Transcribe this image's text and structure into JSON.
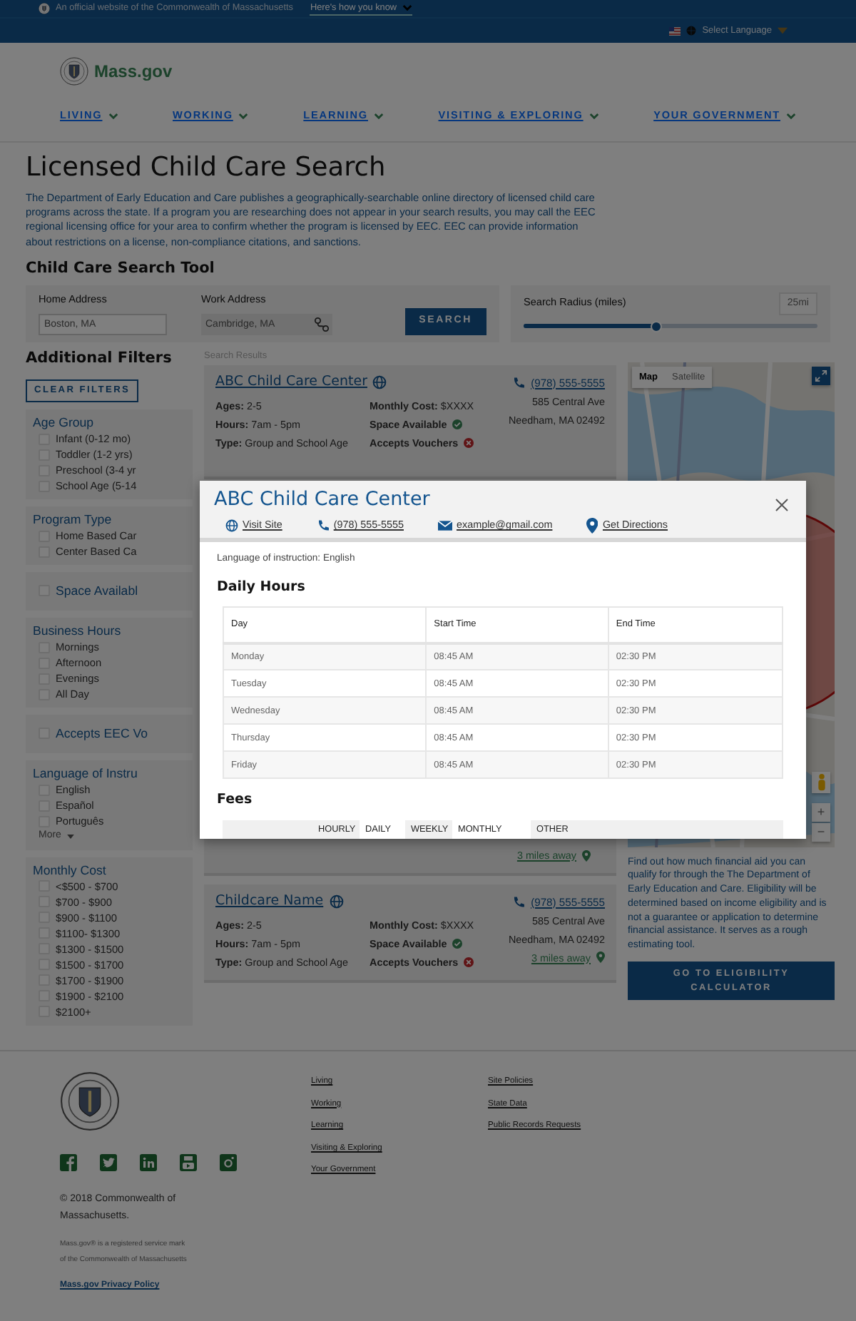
{
  "banner": {
    "text": "An official website of the Commonwealth of Massachusetts",
    "link": "Here's how you know"
  },
  "language_bar": {
    "label": "Select Language"
  },
  "header": {
    "logo": "Mass.gov",
    "nav": [
      "LIVING",
      "WORKING",
      "LEARNING",
      "VISITING & EXPLORING",
      "YOUR GOVERNMENT"
    ]
  },
  "intro": {
    "title": "Licensed Child Care Search",
    "text": "The Department of Early Education and Care publishes a geographically-searchable online directory of licensed child care programs across the state. If a program you are researching does not appear in your search results, you may call the EEC regional licensing office for your area to confirm whether the program is licensed by EEC. EEC can provide information about restrictions on a license, non-compliance citations, and sanctions."
  },
  "search_tool": {
    "title": "Child Care Search Tool",
    "home_address": {
      "label": "Home Address",
      "value": "Boston, MA"
    },
    "work_address": {
      "label": "Work Address",
      "value": "Cambridge, MA"
    },
    "search_button": "SEARCH",
    "radius": {
      "label": "Search Radius (miles)",
      "reading": "25mi",
      "level": 0.45
    }
  },
  "filters": {
    "title": "Additional Filters",
    "clear_button": "CLEAR FILTERS",
    "groups": [
      {
        "kind": "list",
        "title": "Age Group",
        "options": [
          {
            "label": "Infant (0-12 mo)",
            "checked": false
          },
          {
            "label": "Toddler (1-2 yrs)",
            "checked": false
          },
          {
            "label": "Preschool (3-4 yr",
            "checked": false
          },
          {
            "label": "School Age (5-14",
            "checked": false
          }
        ]
      },
      {
        "kind": "list",
        "title": "Program Type",
        "options": [
          {
            "label": "Home Based Car",
            "checked": false
          },
          {
            "label": "Center Based Ca",
            "checked": false
          }
        ]
      },
      {
        "kind": "toggle",
        "title": "Space Availabl",
        "checked": false
      },
      {
        "kind": "list",
        "title": "Business Hours",
        "options": [
          {
            "label": "Mornings",
            "checked": false
          },
          {
            "label": "Afternoon",
            "checked": false
          },
          {
            "label": "Evenings",
            "checked": false
          },
          {
            "label": "All Day",
            "checked": false
          }
        ]
      },
      {
        "kind": "toggle",
        "title": "Accepts EEC Vo",
        "checked": false
      },
      {
        "kind": "list",
        "title": "Language of Instru",
        "options": [
          {
            "label": "English",
            "checked": false
          },
          {
            "label": "Español",
            "checked": false
          },
          {
            "label": "Português",
            "checked": false
          }
        ],
        "more": "More"
      },
      {
        "kind": "list",
        "title": "Monthly Cost",
        "options": [
          {
            "label": "<$500 - $700",
            "checked": false
          },
          {
            "label": "$700 - $900",
            "checked": false
          },
          {
            "label": "$900 - $1100",
            "checked": false
          },
          {
            "label": "$1100- $1300",
            "checked": false
          },
          {
            "label": "$1300 - $1500",
            "checked": false
          },
          {
            "label": "$1500 - $1700",
            "checked": false
          },
          {
            "label": "$1700 - $1900",
            "checked": false
          },
          {
            "label": "$1900 - $2100",
            "checked": false
          },
          {
            "label": "$2100+",
            "checked": false
          }
        ]
      }
    ]
  },
  "results": {
    "label": "Search Results",
    "cards": [
      {
        "kind": "full",
        "name": "ABC Child Care Center",
        "details": [
          "**Ages:** 2-5",
          "**Hours:** 7am - 5pm",
          "**Type:** Group and School Age"
        ],
        "facts": [
          {
            "kind": "text",
            "text": "**Monthly Cost:** $XXXX"
          },
          {
            "kind": "flag",
            "text": "Space Available",
            "positive": true
          },
          {
            "kind": "flag",
            "text": "Accepts Vouchers",
            "positive": false
          }
        ],
        "phone": "(978) 555-5555",
        "address": [
          "585 Central Ave",
          "Needham, MA 02492"
        ]
      },
      {
        "kind": "partial",
        "distance": "3 miles away"
      },
      {
        "kind": "full",
        "name": "Childcare Name",
        "details": [
          "**Ages:** 2-5",
          "**Hours:** 7am - 5pm",
          "**Type:** Group and School Age"
        ],
        "facts": [
          {
            "kind": "text",
            "text": "**Monthly Cost:** $XXXX"
          },
          {
            "kind": "flag",
            "text": "Space Available",
            "positive": true
          },
          {
            "kind": "flag",
            "text": "Accepts Vouchers",
            "positive": false
          }
        ],
        "phone": "(978) 555-5555",
        "address": [
          "585 Central Ave",
          "Needham, MA 02492"
        ],
        "distance": "3 miles away"
      }
    ]
  },
  "map": {
    "tabs": [
      {
        "label": "Map",
        "selected": true
      },
      {
        "label": "Satellite",
        "selected": false
      }
    ],
    "zoom_in": "+",
    "zoom_out": "−"
  },
  "aid": {
    "text": "Find out how much financial aid you can qualify for through the The Department of Early Education and Care. Eligibility will be determined based on income eligibility and is not a guarantee or application to determine financial assistance. It serves as a rough estimating tool.",
    "button": "GO TO ELIGIBILITY CALCULATOR"
  },
  "modal": {
    "title": "ABC Child Care Center",
    "actions": [
      {
        "kind": "web",
        "label": "Visit Site"
      },
      {
        "kind": "phone",
        "label": "(978) 555-5555"
      },
      {
        "kind": "email",
        "label": "example@gmail.com"
      },
      {
        "kind": "directions",
        "label": "Get Directions"
      }
    ],
    "language": "Language of instruction: English",
    "hours_title": "Daily Hours",
    "hours": {
      "columns": [
        "Day",
        "Start Time",
        "End Time"
      ],
      "rows": [
        [
          "Monday",
          "08:45 AM",
          "02:30 PM"
        ],
        [
          "Tuesday",
          "08:45 AM",
          "02:30 PM"
        ],
        [
          "Wednesday",
          "08:45 AM",
          "02:30 PM"
        ],
        [
          "Thursday",
          "08:45 AM",
          "02:30 PM"
        ],
        [
          "Friday",
          "08:45 AM",
          "02:30 PM"
        ]
      ]
    },
    "fees_title": "Fees",
    "fees_columns": [
      "HOURLY",
      "DAILY",
      "WEEKLY",
      "MONTHLY",
      "OTHER"
    ]
  },
  "footer": {
    "social": [
      {
        "kind": "facebook"
      },
      {
        "kind": "twitter"
      },
      {
        "kind": "linkedin"
      },
      {
        "kind": "youtube"
      },
      {
        "kind": "instagram"
      }
    ],
    "copyright": "© 2018 Commonwealth of Massachusetts.",
    "trademark": "Mass.gov® is a registered service mark of the Commonwealth of Massachusetts",
    "privacy": "Mass.gov Privacy Policy",
    "links_1": [
      "Living",
      "Working",
      "Learning",
      "Visiting & Exploring",
      "Your Government"
    ],
    "links_2": [
      "Site Policies",
      "State Data",
      "Public Records Requests"
    ]
  }
}
